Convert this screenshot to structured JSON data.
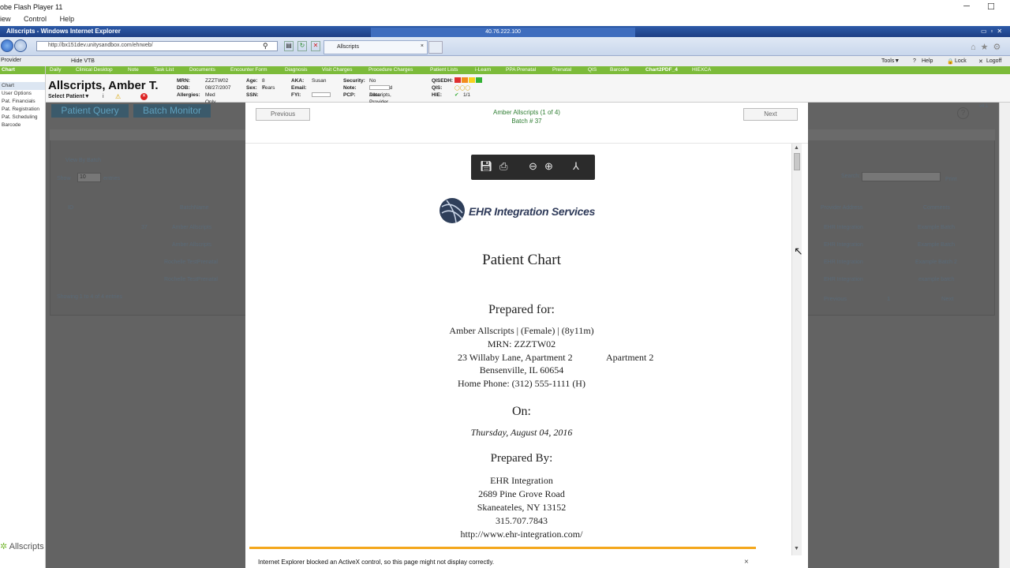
{
  "flash": {
    "title": "obe Flash Player 11",
    "menu": [
      "iew",
      "Control",
      "Help"
    ],
    "minimize": "─",
    "maximize": "☐"
  },
  "ie": {
    "title": "Allscripts - Windows Internet Explorer",
    "remote_ip": "40.76.222.100",
    "url": "http://bx151dev.unitysandbox.com/ehrweb/",
    "tab": "Allscripts",
    "right_tools": [
      "⌂",
      "★",
      "⚙"
    ]
  },
  "provider_bar": {
    "provider": "Provider",
    "hide_vtb": "Hide VTB",
    "tools": "Tools▼",
    "help": "Help",
    "lock": "Lock",
    "logoff": "Logoff"
  },
  "nav_tabs": [
    "Daily",
    "Clinical Desktop",
    "Note",
    "Task List",
    "Documents",
    "Encounter Form",
    "Diagnosis",
    "Visit Charges",
    "Procedure Charges",
    "Patient Lists",
    "i-Learn",
    "PPA Prenatal",
    "Prenatal",
    "QIS",
    "Barcode",
    "Chart2PDF_4",
    "HIEXCA"
  ],
  "left_nav": [
    "Chart",
    "User Options",
    "Pat. Financials",
    "Pat. Registration",
    "Pat. Scheduling",
    "Barcode"
  ],
  "left_footer": "Allscripts",
  "patient": {
    "name": "Allscripts, Amber T.",
    "select": "Select Patient▼",
    "mrn_l": "MRN:",
    "mrn": "ZZZTW02",
    "dob_l": "DOB:",
    "dob": "08/27/2007",
    "allergies_l": "Allergies:",
    "allergies": "Med Only",
    "age_l": "Age:",
    "age": "8 Years",
    "sex_l": "Sex:",
    "sex": "F",
    "ssn_l": "SSN:",
    "aka_l": "AKA:",
    "aka": "Susan",
    "email_l": "Email:",
    "fyi_l": "FYI:",
    "security_l": "Security:",
    "security": "No Restricted Data",
    "note_l": "Note:",
    "pcp_l": "PCP:",
    "pcp": "Allscripts, Provider",
    "qisedh_l": "QISEDH:",
    "qis_l": "QIS:",
    "hie_l": "HIE:",
    "hie": "1/1"
  },
  "background": {
    "patient_query": "Patient Query",
    "batch_monitor": "Batch Monitor",
    "view_by_batch": "View By Batch",
    "show": "Show",
    "entries_count": "10",
    "entries": "entries",
    "search": "Search:",
    "print": "Print",
    "col_id": "ID",
    "col_batch": "BatchName",
    "col_provaddr": "Provider Address",
    "col_comments": "Comments",
    "rows": [
      {
        "id": "37",
        "name": "Amber Allscripts",
        "addr": "EHR Integration",
        "comment": "Example Batch"
      },
      {
        "id": "36",
        "name": "Amber Allscripts",
        "addr": "EHR Integration",
        "comment": "Example Batch"
      },
      {
        "id": "35",
        "name": "Rochelle TestPrenatal",
        "addr": "EHR Integration",
        "comment": "Example Batch 2"
      },
      {
        "id": "34",
        "name": "Rochelle TestPrenatal",
        "addr": "EHR Integration",
        "comment": "example batch"
      }
    ],
    "showing": "Showing 1 to 4 of 4 entries",
    "prev": "Previous",
    "page": "1",
    "next": "Next",
    "version": "v4.1"
  },
  "viewer": {
    "prev": "Previous",
    "next": "Next",
    "heading": "Amber Allscripts (1 of 4)",
    "batch": "Batch # 37"
  },
  "doc": {
    "logo_text": "EHR Integration Services",
    "title": "Patient Chart",
    "prepared_for": "Prepared for:",
    "patient_line": "Amber Allscripts | (Female) | (8y11m)",
    "mrn_line": "MRN: ZZZTW02",
    "addr1": "23 Willaby Lane, Apartment 2",
    "addr1b": "Apartment 2",
    "addr2": "Bensenville, IL 60654",
    "phone": "Home Phone: (312) 555-1111 (H)",
    "on": "On:",
    "date": "Thursday, August 04, 2016",
    "prepared_by": "Prepared By:",
    "org": "EHR Integration",
    "org_addr1": "2689 Pine Grove Road",
    "org_addr2": "Skaneateles, NY 13152",
    "org_phone": "315.707.7843",
    "org_url": "http://www.ehr-integration.com/"
  },
  "infobar": {
    "message": "Internet Explorer blocked an ActiveX control, so this page might not display correctly.",
    "close": "×"
  }
}
